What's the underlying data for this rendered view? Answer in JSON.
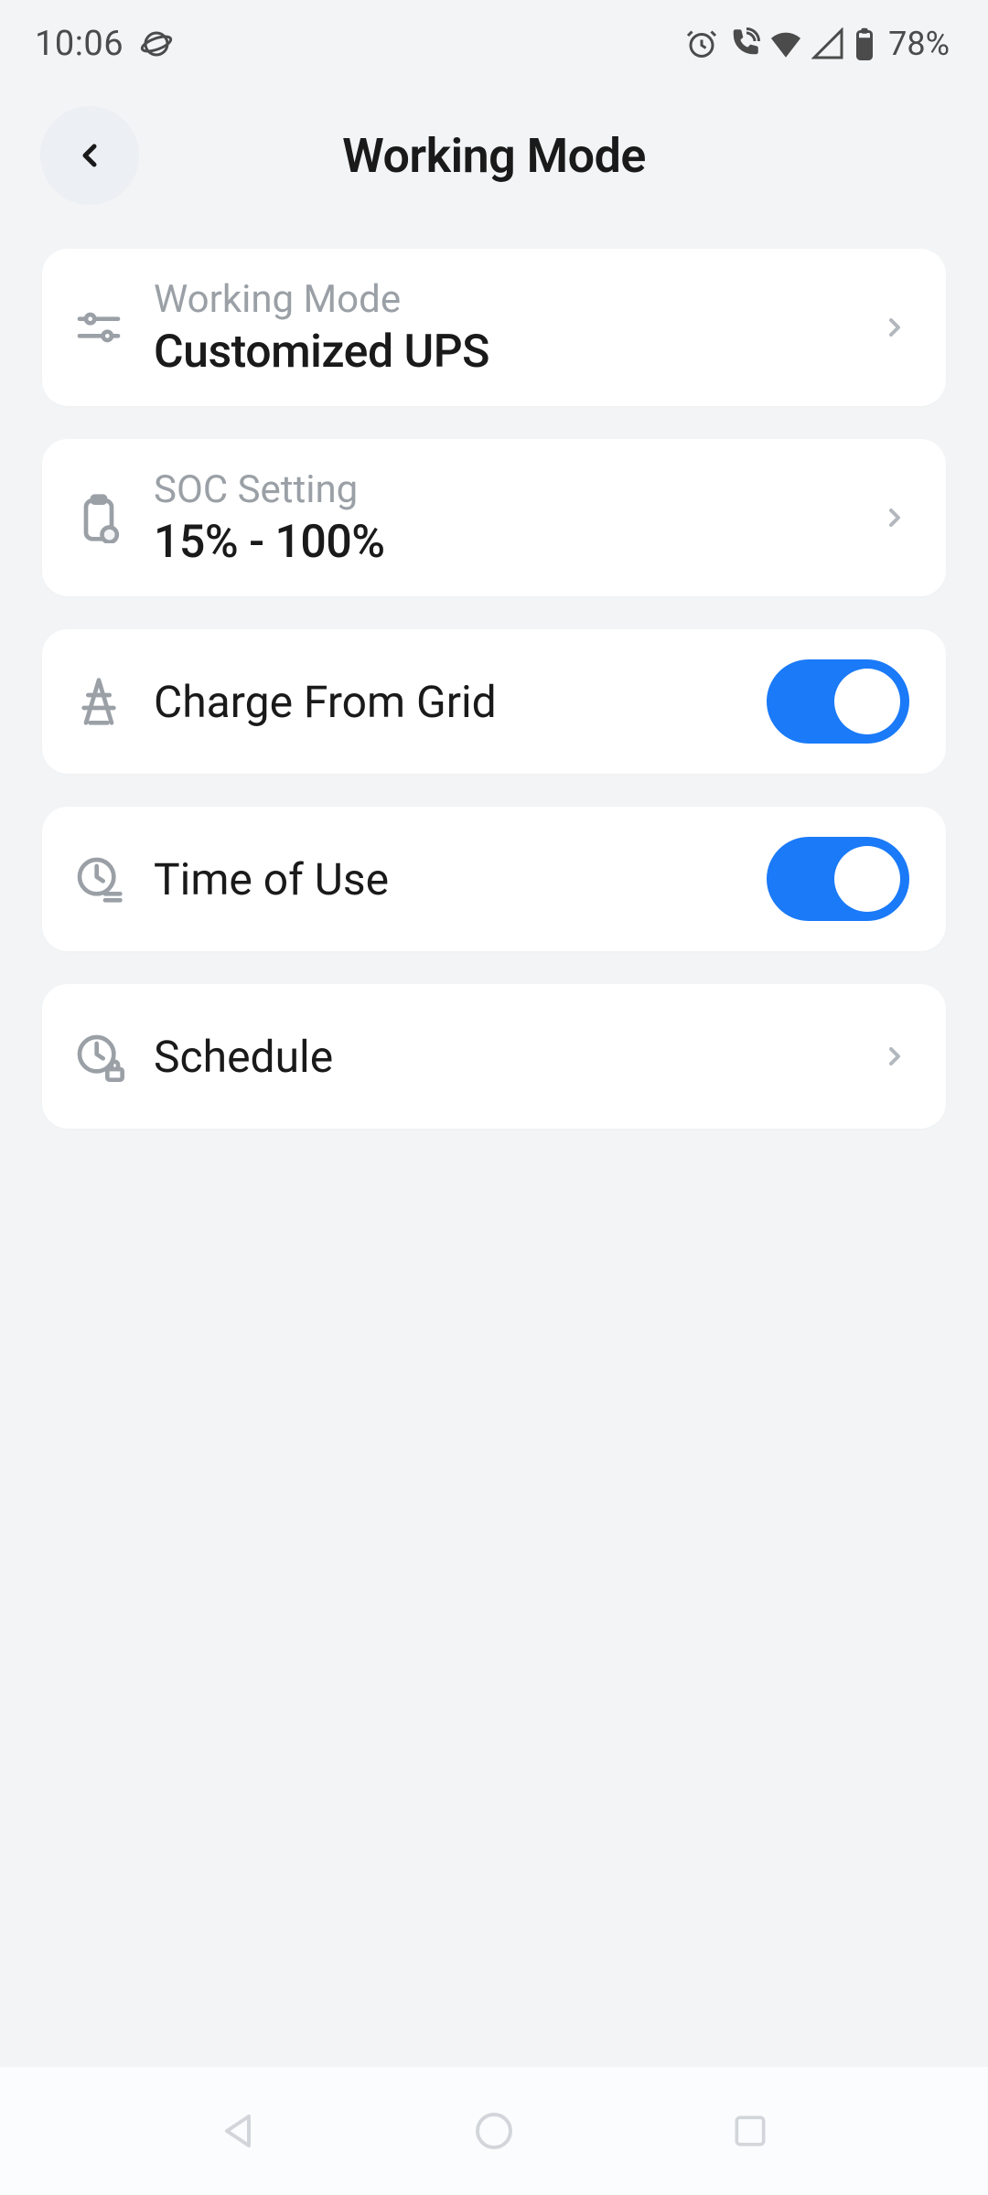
{
  "status": {
    "time": "10:06",
    "battery": "78%"
  },
  "header": {
    "title": "Working Mode"
  },
  "rows": {
    "workingMode": {
      "label": "Working Mode",
      "value": "Customized UPS"
    },
    "soc": {
      "label": "SOC Setting",
      "value": "15% - 100%"
    },
    "chargeFromGrid": {
      "label": "Charge From Grid",
      "on": true
    },
    "timeOfUse": {
      "label": "Time of Use",
      "on": true
    },
    "schedule": {
      "label": "Schedule"
    }
  }
}
